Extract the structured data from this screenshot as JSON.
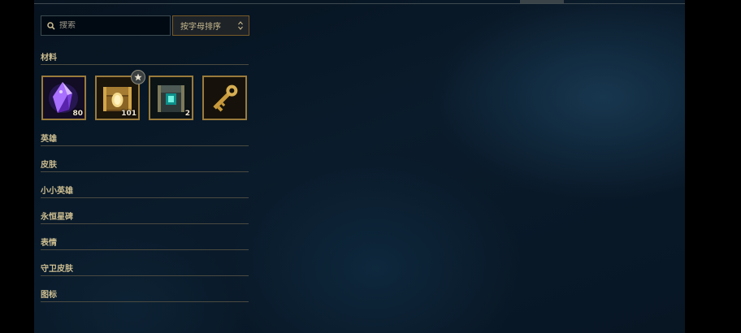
{
  "search": {
    "placeholder": "搜索",
    "icon": "search-icon"
  },
  "sort": {
    "selected": "按字母排序",
    "icon": "sort-caret-icon"
  },
  "categories": [
    {
      "label": "材料"
    },
    {
      "label": "英雄"
    },
    {
      "label": "皮肤"
    },
    {
      "label": "小小英雄"
    },
    {
      "label": "永恒星碑"
    },
    {
      "label": "表情"
    },
    {
      "label": "守卫皮肤"
    },
    {
      "label": "图标"
    }
  ],
  "materials": [
    {
      "icon": "purple-crystal-icon",
      "count": "80"
    },
    {
      "icon": "gold-chest-icon",
      "count": "101",
      "badge": "star-icon"
    },
    {
      "icon": "teal-chest-icon",
      "count": "2"
    },
    {
      "icon": "gold-key-icon",
      "count": ""
    }
  ],
  "colors": {
    "gold_text": "#cdbe91",
    "gold_border": "#9a7b3c",
    "background": "#0a1b2b"
  }
}
